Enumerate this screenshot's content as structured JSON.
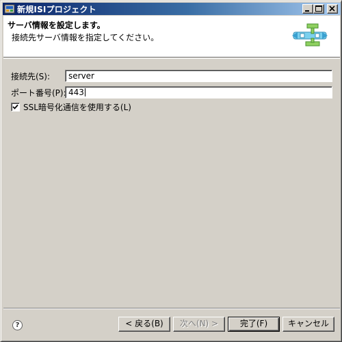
{
  "window": {
    "title": "新規ISIプロジェクト"
  },
  "banner": {
    "title": "サーバ情報を設定します。",
    "description": "接続先サーバ情報を指定してください。"
  },
  "form": {
    "host_label": "接続先(S):",
    "host_value": "server",
    "port_label": "ポート番号(P):",
    "port_value": "443",
    "ssl_label": "SSL暗号化通信を使用する(L)",
    "ssl_checked": true
  },
  "buttons": {
    "back": "< 戻る(B)",
    "next": "次へ(N) >",
    "finish": "完了(F)",
    "cancel": "キャンセル"
  },
  "colors": {
    "titlebar_start": "#0a246a",
    "titlebar_end": "#a6caf0",
    "dialog_bg": "#d4d0c8"
  }
}
